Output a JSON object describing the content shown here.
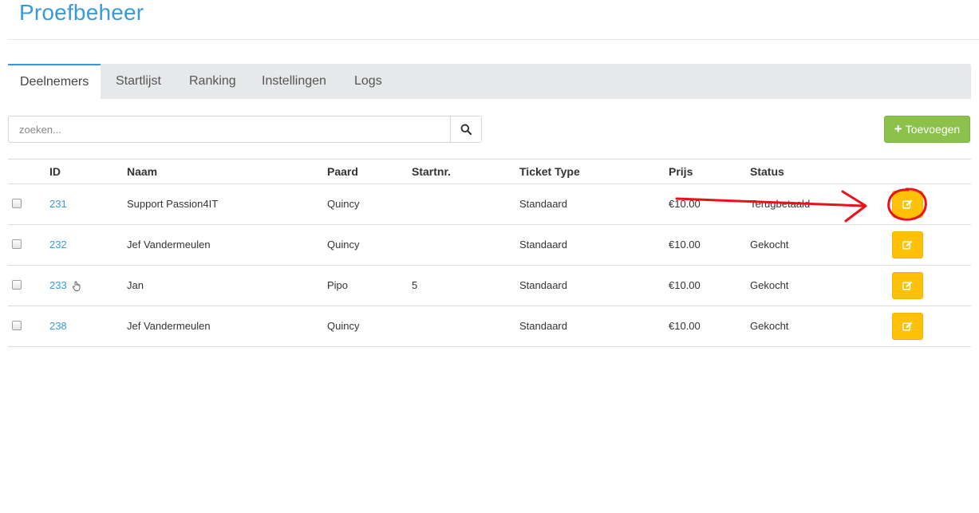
{
  "header": {
    "title": "Proefbeheer"
  },
  "tabs": [
    {
      "label": "Deelnemers",
      "active": true
    },
    {
      "label": "Startlijst",
      "active": false
    },
    {
      "label": "Ranking",
      "active": false
    },
    {
      "label": "Instellingen",
      "active": false
    },
    {
      "label": "Logs",
      "active": false
    }
  ],
  "search": {
    "placeholder": "zoeken...",
    "value": "",
    "icon": "search-icon"
  },
  "toolbar": {
    "add_label": "Toevoegen",
    "add_icon": "plus-icon",
    "add_color": "#8cc14c"
  },
  "table": {
    "columns": {
      "id": "ID",
      "naam": "Naam",
      "paard": "Paard",
      "startnr": "Startnr.",
      "ticket_type": "Ticket Type",
      "prijs": "Prijs",
      "status": "Status"
    },
    "rows": [
      {
        "id": "231",
        "naam": "Support Passion4IT",
        "paard": "Quincy",
        "startnr": "",
        "ticket_type": "Standaard",
        "prijs": "€10.00",
        "status": "Terugbetaald"
      },
      {
        "id": "232",
        "naam": "Jef Vandermeulen",
        "paard": "Quincy",
        "startnr": "",
        "ticket_type": "Standaard",
        "prijs": "€10.00",
        "status": "Gekocht"
      },
      {
        "id": "233",
        "naam": "Jan",
        "paard": "Pipo",
        "startnr": "5",
        "ticket_type": "Standaard",
        "prijs": "€10.00",
        "status": "Gekocht"
      },
      {
        "id": "238",
        "naam": "Jef Vandermeulen",
        "paard": "Quincy",
        "startnr": "",
        "ticket_type": "Standaard",
        "prijs": "€10.00",
        "status": "Gekocht"
      }
    ],
    "edit_icon": "edit-icon",
    "edit_color": "#ffc107"
  },
  "annotation": {
    "color": "#e8121a",
    "type": "red-arrow-and-circle"
  }
}
